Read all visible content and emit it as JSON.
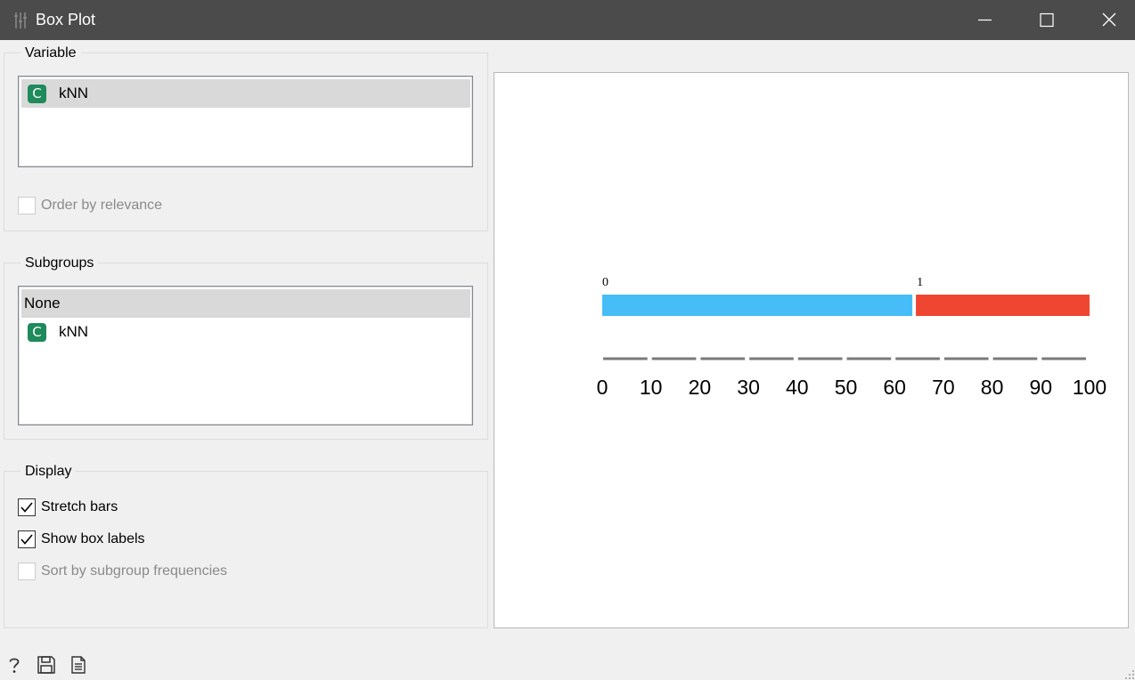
{
  "window": {
    "title": "Box Plot",
    "icons": [
      "app-icon",
      "minimize-icon",
      "maximize-icon",
      "close-icon"
    ]
  },
  "variable": {
    "title": "Variable",
    "items": [
      {
        "badge": "C",
        "name": "kNN",
        "color": "#1f8a5c"
      }
    ],
    "order_by_relevance": {
      "label": "Order by relevance",
      "checked": false,
      "enabled": false
    }
  },
  "subgroups": {
    "title": "Subgroups",
    "none_label": "None",
    "items": [
      {
        "badge": "C",
        "name": "kNN",
        "color": "#1f8a5c"
      }
    ]
  },
  "display": {
    "title": "Display",
    "stretch_bars": {
      "label": "Stretch bars",
      "checked": true
    },
    "show_box_labels": {
      "label": "Show box labels",
      "checked": true
    },
    "sort_by_subgroup_frequencies": {
      "label": "Sort by subgroup frequencies",
      "checked": false,
      "enabled": false
    }
  },
  "footer": {
    "icons": [
      "help-icon",
      "save-icon",
      "report-icon"
    ]
  },
  "chart_data": {
    "type": "bar",
    "orientation": "horizontal-stacked",
    "categories": [
      "0",
      "1"
    ],
    "values": [
      64,
      36
    ],
    "colors": [
      "#46bdf7",
      "#ef4631"
    ],
    "xlim": [
      0,
      100
    ],
    "xticks": [
      "0",
      "10",
      "20",
      "30",
      "40",
      "50",
      "60",
      "70",
      "80",
      "90",
      "100"
    ]
  }
}
